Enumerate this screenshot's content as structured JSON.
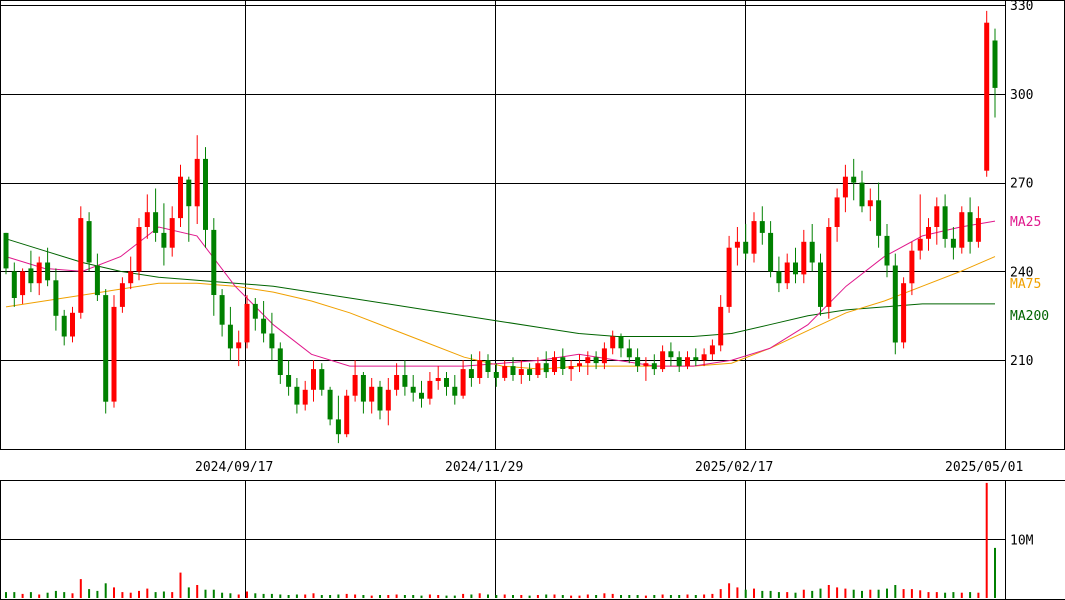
{
  "chart_data": {
    "type": "candlestick",
    "y_axis": {
      "ticks": [
        210,
        240,
        270,
        300,
        330
      ],
      "range": [
        180,
        331
      ]
    },
    "x_axis": {
      "date_labels": [
        "2024/09/17",
        "2024/11/29",
        "2025/02/17",
        "2025/05/01"
      ]
    },
    "moving_averages": [
      {
        "name": "MA25",
        "color": "#e0188c"
      },
      {
        "name": "MA75",
        "color": "#f0a000"
      },
      {
        "name": "MA200",
        "color": "#006400"
      }
    ],
    "volume_axis": {
      "ticks": [
        "10M"
      ],
      "tick_values": [
        10
      ],
      "max": 20
    },
    "colors": {
      "up": "#ff0000",
      "down": "#008000",
      "grid": "#000000"
    },
    "candles": [
      [
        0,
        253,
        253,
        239,
        241
      ],
      [
        1,
        240,
        243,
        228,
        231
      ],
      [
        2,
        232,
        241,
        229,
        240
      ],
      [
        3,
        241,
        247,
        233,
        236
      ],
      [
        4,
        236,
        245,
        232,
        243
      ],
      [
        5,
        243,
        248,
        235,
        237
      ],
      [
        6,
        237,
        241,
        220,
        225
      ],
      [
        7,
        225,
        227,
        215,
        218
      ],
      [
        8,
        218,
        228,
        216,
        226
      ],
      [
        9,
        226,
        262,
        224,
        258
      ],
      [
        10,
        257,
        260,
        240,
        243
      ],
      [
        11,
        242,
        246,
        230,
        232
      ],
      [
        12,
        232,
        234,
        192,
        196
      ],
      [
        13,
        196,
        232,
        194,
        228
      ],
      [
        14,
        228,
        238,
        226,
        236
      ],
      [
        15,
        236,
        245,
        234,
        240
      ],
      [
        16,
        240,
        258,
        237,
        255
      ],
      [
        17,
        255,
        266,
        251,
        260
      ],
      [
        18,
        260,
        268,
        250,
        253
      ],
      [
        19,
        253,
        263,
        242,
        248
      ],
      [
        20,
        248,
        262,
        245,
        258
      ],
      [
        21,
        258,
        276,
        255,
        272
      ],
      [
        22,
        271,
        272,
        250,
        262
      ],
      [
        23,
        262,
        286,
        256,
        278
      ],
      [
        24,
        278,
        282,
        248,
        254
      ],
      [
        25,
        254,
        258,
        225,
        232
      ],
      [
        26,
        232,
        234,
        218,
        222
      ],
      [
        27,
        222,
        228,
        210,
        214
      ],
      [
        28,
        214,
        220,
        208,
        216
      ],
      [
        29,
        216,
        232,
        214,
        229
      ],
      [
        30,
        229,
        231,
        220,
        224
      ],
      [
        31,
        224,
        230,
        216,
        219
      ],
      [
        32,
        219,
        226,
        210,
        214
      ],
      [
        33,
        214,
        216,
        202,
        205
      ],
      [
        34,
        205,
        210,
        198,
        201
      ],
      [
        35,
        201,
        204,
        192,
        195
      ],
      [
        36,
        195,
        203,
        193,
        200
      ],
      [
        37,
        200,
        210,
        196,
        207
      ],
      [
        38,
        207,
        209,
        198,
        200
      ],
      [
        39,
        200,
        201,
        188,
        190
      ],
      [
        40,
        190,
        198,
        182,
        185
      ],
      [
        41,
        185,
        200,
        184,
        198
      ],
      [
        42,
        198,
        210,
        196,
        205
      ],
      [
        43,
        205,
        206,
        192,
        196
      ],
      [
        44,
        196,
        204,
        192,
        201
      ],
      [
        45,
        201,
        203,
        190,
        193
      ],
      [
        46,
        193,
        204,
        188,
        200
      ],
      [
        47,
        200,
        209,
        198,
        205
      ],
      [
        48,
        205,
        210,
        198,
        201
      ],
      [
        49,
        201,
        205,
        196,
        199
      ],
      [
        50,
        199,
        203,
        194,
        197
      ],
      [
        51,
        197,
        206,
        195,
        203
      ],
      [
        52,
        203,
        208,
        200,
        204
      ],
      [
        53,
        204,
        206,
        198,
        201
      ],
      [
        54,
        201,
        205,
        195,
        198
      ],
      [
        55,
        198,
        210,
        197,
        207
      ],
      [
        56,
        207,
        212,
        201,
        204
      ],
      [
        57,
        204,
        213,
        202,
        210
      ],
      [
        58,
        210,
        212,
        204,
        206
      ],
      [
        59,
        206,
        209,
        201,
        204
      ],
      [
        60,
        204,
        210,
        203,
        208
      ],
      [
        61,
        208,
        211,
        203,
        205
      ],
      [
        62,
        205,
        210,
        202,
        207
      ],
      [
        63,
        207,
        209,
        203,
        205
      ],
      [
        64,
        205,
        211,
        204,
        209
      ],
      [
        65,
        209,
        213,
        204,
        206
      ],
      [
        66,
        206,
        213,
        205,
        211
      ],
      [
        67,
        211,
        214,
        205,
        207
      ],
      [
        68,
        207,
        210,
        203,
        208
      ],
      [
        69,
        208,
        212,
        206,
        209
      ],
      [
        70,
        209,
        213,
        205,
        211
      ],
      [
        71,
        211,
        213,
        207,
        209
      ],
      [
        72,
        209,
        216,
        207,
        214
      ],
      [
        73,
        214,
        220,
        212,
        218
      ],
      [
        74,
        218,
        219,
        211,
        214
      ],
      [
        75,
        214,
        217,
        209,
        211
      ],
      [
        76,
        211,
        214,
        206,
        208
      ],
      [
        77,
        208,
        211,
        203,
        209
      ],
      [
        78,
        209,
        212,
        205,
        207
      ],
      [
        79,
        207,
        215,
        206,
        213
      ],
      [
        80,
        213,
        216,
        208,
        211
      ],
      [
        81,
        211,
        213,
        206,
        208
      ],
      [
        82,
        208,
        213,
        207,
        211
      ],
      [
        83,
        211,
        214,
        208,
        210
      ],
      [
        84,
        210,
        214,
        208,
        212
      ],
      [
        85,
        212,
        217,
        210,
        215
      ],
      [
        86,
        215,
        232,
        213,
        228
      ],
      [
        87,
        228,
        252,
        226,
        248
      ],
      [
        88,
        248,
        255,
        242,
        250
      ],
      [
        89,
        250,
        256,
        244,
        246
      ],
      [
        90,
        246,
        260,
        243,
        257
      ],
      [
        91,
        257,
        262,
        249,
        253
      ],
      [
        92,
        253,
        257,
        238,
        240
      ],
      [
        93,
        240,
        245,
        233,
        236
      ],
      [
        94,
        236,
        246,
        234,
        243
      ],
      [
        95,
        243,
        248,
        236,
        239
      ],
      [
        96,
        239,
        254,
        236,
        250
      ],
      [
        97,
        250,
        256,
        240,
        243
      ],
      [
        98,
        243,
        246,
        225,
        228
      ],
      [
        99,
        228,
        258,
        224,
        255
      ],
      [
        100,
        255,
        268,
        250,
        265
      ],
      [
        101,
        265,
        276,
        260,
        272
      ],
      [
        102,
        272,
        278,
        264,
        270
      ],
      [
        103,
        270,
        274,
        260,
        262
      ],
      [
        104,
        262,
        268,
        257,
        264
      ],
      [
        105,
        264,
        270,
        248,
        252
      ],
      [
        106,
        252,
        256,
        238,
        242
      ],
      [
        107,
        242,
        246,
        212,
        216
      ],
      [
        108,
        216,
        238,
        214,
        236
      ],
      [
        109,
        236,
        250,
        232,
        247
      ],
      [
        110,
        247,
        266,
        244,
        251
      ],
      [
        111,
        251,
        258,
        247,
        255
      ],
      [
        112,
        255,
        265,
        249,
        262
      ],
      [
        113,
        262,
        266,
        248,
        251
      ],
      [
        114,
        251,
        255,
        244,
        248
      ],
      [
        115,
        248,
        262,
        246,
        260
      ],
      [
        116,
        260,
        265,
        246,
        250
      ],
      [
        117,
        250,
        262,
        248,
        258
      ],
      [
        118,
        274,
        328,
        272,
        324
      ],
      [
        119,
        318,
        322,
        292,
        302
      ]
    ],
    "ma25": [
      [
        0,
        245
      ],
      [
        10,
        241
      ],
      [
        20,
        240
      ],
      [
        30,
        245
      ],
      [
        40,
        255
      ],
      [
        50,
        252
      ],
      [
        60,
        235
      ],
      [
        70,
        222
      ],
      [
        80,
        212
      ],
      [
        90,
        208
      ],
      [
        100,
        208
      ],
      [
        110,
        208
      ],
      [
        120,
        208
      ],
      [
        130,
        209
      ],
      [
        140,
        210
      ],
      [
        150,
        212
      ],
      [
        160,
        210
      ],
      [
        170,
        208
      ],
      [
        180,
        208
      ],
      [
        190,
        210
      ],
      [
        200,
        214
      ],
      [
        210,
        222
      ],
      [
        220,
        235
      ],
      [
        230,
        245
      ],
      [
        240,
        252
      ],
      [
        250,
        255
      ],
      [
        259,
        257
      ]
    ],
    "ma75": [
      [
        0,
        228
      ],
      [
        10,
        230
      ],
      [
        20,
        232
      ],
      [
        30,
        234
      ],
      [
        40,
        236
      ],
      [
        50,
        236
      ],
      [
        60,
        235
      ],
      [
        70,
        233
      ],
      [
        80,
        230
      ],
      [
        90,
        226
      ],
      [
        100,
        221
      ],
      [
        110,
        216
      ],
      [
        120,
        211
      ],
      [
        130,
        208
      ],
      [
        140,
        207
      ],
      [
        150,
        208
      ],
      [
        160,
        208
      ],
      [
        170,
        208
      ],
      [
        180,
        208
      ],
      [
        190,
        209
      ],
      [
        200,
        214
      ],
      [
        210,
        220
      ],
      [
        220,
        226
      ],
      [
        230,
        230
      ],
      [
        240,
        235
      ],
      [
        250,
        240
      ],
      [
        259,
        245
      ]
    ],
    "ma200": [
      [
        0,
        251
      ],
      [
        10,
        247
      ],
      [
        20,
        243
      ],
      [
        30,
        240
      ],
      [
        40,
        238
      ],
      [
        50,
        237
      ],
      [
        60,
        236
      ],
      [
        70,
        235
      ],
      [
        80,
        233
      ],
      [
        90,
        231
      ],
      [
        100,
        229
      ],
      [
        110,
        227
      ],
      [
        120,
        225
      ],
      [
        130,
        223
      ],
      [
        140,
        221
      ],
      [
        150,
        219
      ],
      [
        160,
        218
      ],
      [
        170,
        218
      ],
      [
        180,
        218
      ],
      [
        190,
        219
      ],
      [
        200,
        222
      ],
      [
        210,
        225
      ],
      [
        220,
        227
      ],
      [
        230,
        228
      ],
      [
        240,
        229
      ],
      [
        250,
        229
      ],
      [
        259,
        229
      ]
    ],
    "volume_m": [
      1,
      1,
      0.7,
      1,
      0.6,
      0.9,
      1.2,
      1,
      0.8,
      3.2,
      1.5,
      1.2,
      2.5,
      1.8,
      1,
      0.9,
      1.2,
      1.6,
      1,
      1.1,
      1,
      4.3,
      1.8,
      2.2,
      1.4,
      1.4,
      0.9,
      0.8,
      0.6,
      1.1,
      0.8,
      0.7,
      0.7,
      0.6,
      0.5,
      0.6,
      0.6,
      0.8,
      0.5,
      0.5,
      0.6,
      0.7,
      0.6,
      0.5,
      0.4,
      0.5,
      0.5,
      0.6,
      0.5,
      0.5,
      0.4,
      0.6,
      0.5,
      0.4,
      0.4,
      0.7,
      0.6,
      0.8,
      0.6,
      0.5,
      0.6,
      0.5,
      0.5,
      0.4,
      0.5,
      0.6,
      0.6,
      0.5,
      0.4,
      0.4,
      0.6,
      0.5,
      0.8,
      0.7,
      0.5,
      0.5,
      0.5,
      0.4,
      0.5,
      0.6,
      0.5,
      0.5,
      0.6,
      0.5,
      0.6,
      0.7,
      1.5,
      2.5,
      1.8,
      1.4,
      1.6,
      1.2,
      1.2,
      1,
      1,
      0.9,
      1.4,
      1.2,
      1.6,
      2.2,
      1.8,
      1.6,
      1.4,
      1.2,
      1.4,
      1.4,
      1.6,
      2.2,
      1.5,
      1.5,
      1.3,
      1.0,
      1.0,
      0.9,
      1.0,
      0.9,
      1.0,
      0.9,
      19.5,
      8.5
    ]
  }
}
